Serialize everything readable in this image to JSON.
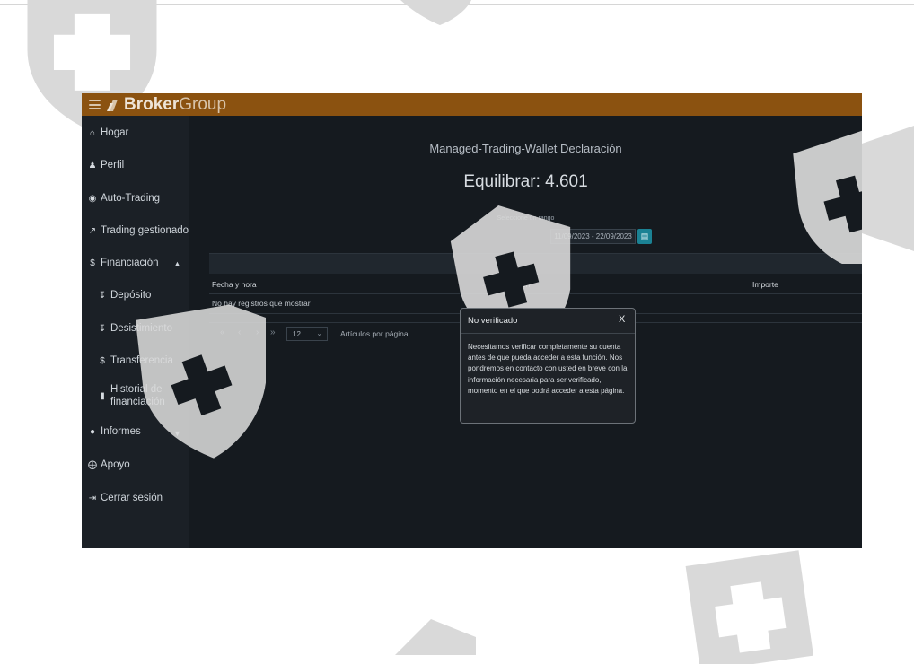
{
  "brand": {
    "name_bold": "Broker",
    "name_light": "Group"
  },
  "sidebar": {
    "items": [
      {
        "label": "Hogar",
        "icon": "home-icon"
      },
      {
        "label": "Perfil",
        "icon": "user-icon"
      },
      {
        "label": "Auto-Trading",
        "icon": "robot-icon"
      },
      {
        "label": "Trading gestionado",
        "icon": "trend-icon"
      },
      {
        "label": "Financiación",
        "icon": "money-icon"
      },
      {
        "label": "Depósito",
        "icon": "deposit-icon"
      },
      {
        "label": "Desistimiento",
        "icon": "withdraw-icon"
      },
      {
        "label": "Transferencia",
        "icon": "transfer-icon"
      },
      {
        "label_line1": "Historial de",
        "label_line2": "financiación",
        "icon": "document-icon"
      },
      {
        "label": "Informes",
        "icon": "info-icon"
      },
      {
        "label": "Apoyo",
        "icon": "support-icon"
      },
      {
        "label": "Cerrar sesión",
        "icon": "logout-icon"
      }
    ]
  },
  "main": {
    "page_title": "Managed-Trading-Wallet Declaración",
    "balance": "Equilibrar: 4.601",
    "range_label": "Seleccione un rango",
    "date_range": "11/09/2023 - 22/09/2023",
    "table": {
      "columns": [
        "Fecha y hora",
        "Descripción",
        "Importe"
      ],
      "empty_message": "No hay registros que mostrar"
    },
    "pagination": {
      "first": "«",
      "prev": "‹",
      "next": "›",
      "last": "»",
      "page_size": "12",
      "page_size_label": "Artículos por página"
    }
  },
  "modal": {
    "title": "No verificado",
    "close": "X",
    "body": "Necesitamos verificar completamente su cuenta antes de que pueda acceder a esta función. Nos pondremos en contacto con usted en breve con la información necesaria para ser verificado, momento en el que podrá acceder a esta página."
  },
  "colors": {
    "topbar": "#8b5210",
    "sidebar": "#1b2026",
    "content": "#151a1f",
    "accent": "#1b8294",
    "watermark": "#d9d9d9"
  }
}
